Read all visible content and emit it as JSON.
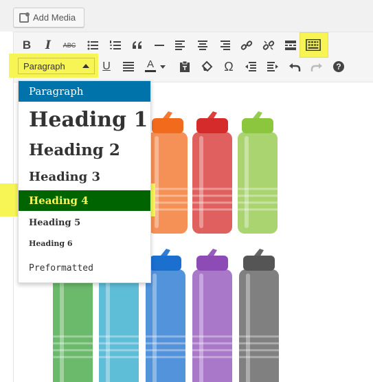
{
  "media": {
    "add_media_label": "Add Media"
  },
  "toolbar": {
    "row1": [
      "bold-icon",
      "italic-icon",
      "strikethrough-icon",
      "bullet-list-icon",
      "numbered-list-icon",
      "blockquote-icon",
      "horizontal-line-icon",
      "align-left-icon",
      "align-center-icon",
      "align-right-icon",
      "insert-link-icon",
      "remove-link-icon",
      "read-more-icon",
      "toolbar-toggle-icon"
    ],
    "row2": [
      "underline-icon",
      "justify-icon",
      "text-color-icon",
      "paste-as-text-icon",
      "clear-formatting-icon",
      "special-character-icon",
      "outdent-icon",
      "indent-icon",
      "undo-icon",
      "redo-icon",
      "help-icon"
    ],
    "format_select_value": "Paragraph",
    "text_color_glyph": "A",
    "underline_glyph": "U",
    "bold_glyph": "B",
    "italic_glyph": "I",
    "strike_glyph": "ABC",
    "omega_glyph": "Ω",
    "help_glyph": "?"
  },
  "format_menu": {
    "items": [
      {
        "label": "Paragraph",
        "state": "active"
      },
      {
        "label": "Heading 1",
        "state": "normal"
      },
      {
        "label": "Heading 2",
        "state": "normal"
      },
      {
        "label": "Heading 3",
        "state": "normal"
      },
      {
        "label": "Heading 4",
        "state": "hover"
      },
      {
        "label": "Heading 5",
        "state": "normal"
      },
      {
        "label": "Heading 6",
        "state": "normal"
      },
      {
        "label": "Preformatted",
        "state": "normal"
      }
    ]
  },
  "colors": {
    "highlight": "#f7f556",
    "active_item": "#0073aa",
    "hover_item": "#006400",
    "hover_text": "#f7f556"
  },
  "content": {
    "bottle_colors_top": [
      "#e2e2e2",
      "#f26b1d",
      "#d52b2b",
      "#8cc63f"
    ],
    "bottle_colors_bottom": [
      "#3aa13a",
      "#29a8c9",
      "#1a6fcf",
      "#8c4bb5",
      "#555555"
    ]
  }
}
